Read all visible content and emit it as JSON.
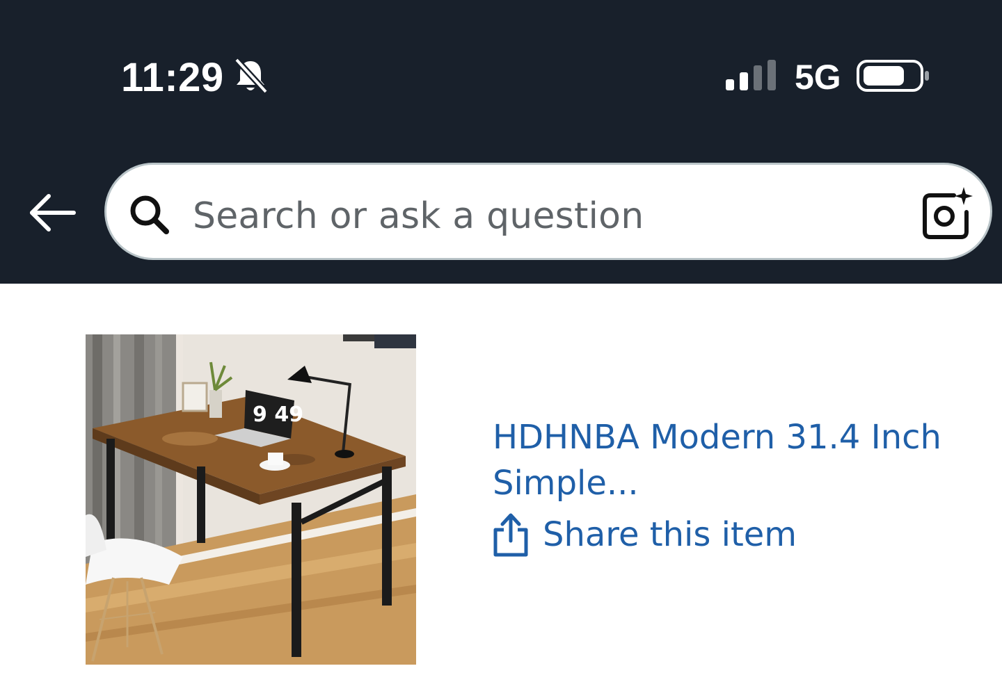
{
  "status_bar": {
    "time": "11:29",
    "network": "5G",
    "icons": [
      "bell-off-icon",
      "signal-icon",
      "battery-icon"
    ]
  },
  "header": {
    "back_icon": "back-arrow-icon",
    "search": {
      "placeholder": "Search or ask a question",
      "icon": "search-icon",
      "lens_icon": "camera-lens-icon"
    }
  },
  "product": {
    "title": "HDHNBA Modern 31.4 Inch Simple...",
    "share_label": "Share this item",
    "share_icon": "share-icon",
    "image_screen_text": "9 49"
  },
  "colors": {
    "header_bg": "#18202b",
    "link_blue": "#1f5fa8",
    "placeholder_gray": "#5f6468"
  }
}
